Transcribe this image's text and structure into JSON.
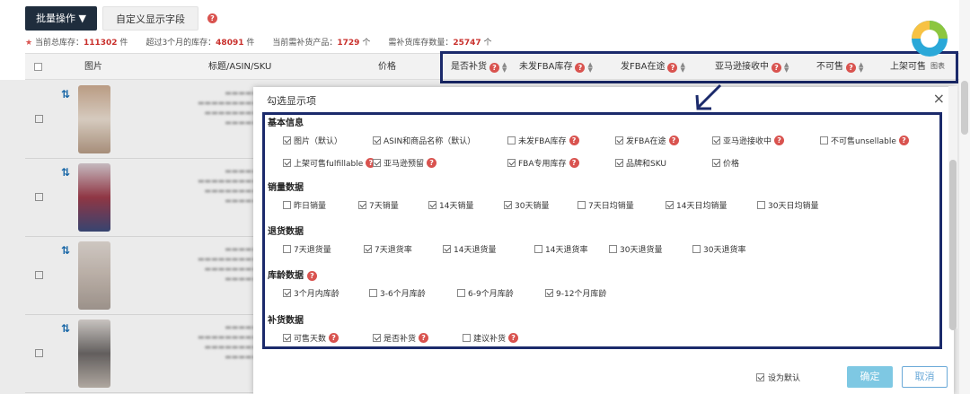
{
  "toolbar": {
    "batch_label": "批量操作 ▼",
    "custom_fields_label": "自定义显示字段"
  },
  "stats": {
    "total_label": "当前总库存：",
    "total_value": "111302",
    "total_unit": "件",
    "over3m_label": "超过3个月的库存：",
    "over3m_value": "48091",
    "over3m_unit": "件",
    "replenish_label": "当前需补货产品：",
    "replenish_value": "1729",
    "replenish_unit": "个",
    "replenish_qty_label": "需补货库存数量：",
    "replenish_qty_value": "25747",
    "replenish_qty_unit": "个"
  },
  "table": {
    "columns": {
      "image": "图片",
      "title": "标题/ASIN/SKU",
      "price": "价格",
      "need_replenish": "是否补货",
      "unshipped_fba": "未发FBA库存",
      "fba_in_transit": "发FBA在途",
      "amazon_receiving": "亚马逊接收中",
      "unsellable": "不可售",
      "fulfillable": "上架可售"
    },
    "badge_label": "图表"
  },
  "modal": {
    "title": "勾选显示项",
    "close": "×",
    "sections": [
      {
        "title": "基本信息",
        "help": false,
        "options": [
          {
            "label": "图片（默认）",
            "checked": true,
            "help": false
          },
          {
            "label": "ASIN和商品名称（默认）",
            "checked": true,
            "help": false
          },
          {
            "label": "未发FBA库存",
            "checked": false,
            "help": true
          },
          {
            "label": "发FBA在途",
            "checked": true,
            "help": true
          },
          {
            "label": "亚马逊接收中",
            "checked": true,
            "help": true
          },
          {
            "label": "不可售unsellable",
            "checked": false,
            "help": true
          },
          {
            "label": "上架可售fulfillable",
            "checked": true,
            "help": true
          },
          {
            "label": "亚马逊预留",
            "checked": true,
            "help": true
          },
          {
            "label": "FBA专用库存",
            "checked": true,
            "help": true
          },
          {
            "label": "品牌和SKU",
            "checked": true,
            "help": false
          },
          {
            "label": "价格",
            "checked": true,
            "help": false
          }
        ]
      },
      {
        "title": "销量数据",
        "help": false,
        "options": [
          {
            "label": "昨日销量",
            "checked": false,
            "help": false
          },
          {
            "label": "7天销量",
            "checked": true,
            "help": false
          },
          {
            "label": "14天销量",
            "checked": true,
            "help": false
          },
          {
            "label": "30天销量",
            "checked": true,
            "help": false
          },
          {
            "label": "7天日均销量",
            "checked": false,
            "help": false
          },
          {
            "label": "14天日均销量",
            "checked": true,
            "help": false
          },
          {
            "label": "30天日均销量",
            "checked": false,
            "help": false
          }
        ]
      },
      {
        "title": "退货数据",
        "help": false,
        "options": [
          {
            "label": "7天退货量",
            "checked": false,
            "help": false
          },
          {
            "label": "7天退货率",
            "checked": true,
            "help": false
          },
          {
            "label": "14天退货量",
            "checked": true,
            "help": false
          },
          {
            "label": "14天退货率",
            "checked": false,
            "help": false
          },
          {
            "label": "30天退货量",
            "checked": false,
            "help": false
          },
          {
            "label": "30天退货率",
            "checked": false,
            "help": false
          }
        ]
      },
      {
        "title": "库龄数据",
        "help": true,
        "options": [
          {
            "label": "3个月内库龄",
            "checked": true,
            "help": false
          },
          {
            "label": "3-6个月库龄",
            "checked": false,
            "help": false
          },
          {
            "label": "6-9个月库龄",
            "checked": false,
            "help": false
          },
          {
            "label": "9-12个月库龄",
            "checked": true,
            "help": false
          }
        ]
      },
      {
        "title": "补货数据",
        "help": false,
        "options": [
          {
            "label": "可售天数",
            "checked": true,
            "help": true
          },
          {
            "label": "是否补货",
            "checked": true,
            "help": true
          },
          {
            "label": "建议补货",
            "checked": false,
            "help": true
          }
        ]
      }
    ],
    "set_default_label": "设为默认",
    "set_default_checked": true,
    "ok_label": "确定",
    "cancel_label": "取消"
  },
  "colors": {
    "highlight_border": "#1b2a6b",
    "primary_dark": "#1f2d3d",
    "help_icon": "#d9534f",
    "ok_button": "#7ec8e3"
  }
}
